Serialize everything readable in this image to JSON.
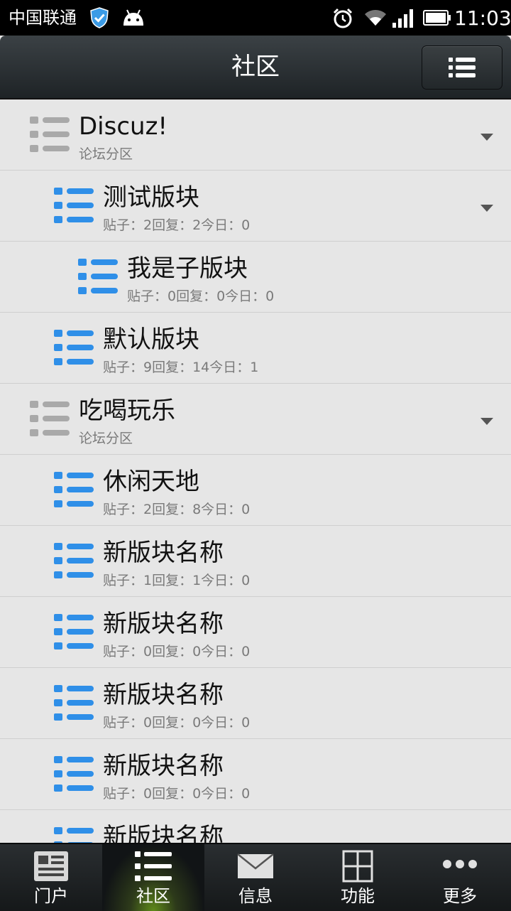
{
  "status_bar": {
    "carrier": "中国联通",
    "time": "11:03"
  },
  "header": {
    "title": "社区"
  },
  "list": {
    "rows": [
      {
        "title": "Discuz!",
        "subtitle": "论坛分区",
        "kind": "category",
        "level": 0,
        "has_arrow": true
      },
      {
        "title": "测试版块",
        "subtitle": "贴子：2回复：2今日：0",
        "kind": "forum",
        "level": 1,
        "has_arrow": true
      },
      {
        "title": "我是子版块",
        "subtitle": "贴子：0回复：0今日：0",
        "kind": "forum",
        "level": 2,
        "has_arrow": false
      },
      {
        "title": "默认版块",
        "subtitle": "贴子：9回复：14今日：1",
        "kind": "forum",
        "level": 1,
        "has_arrow": false
      },
      {
        "title": "吃喝玩乐",
        "subtitle": "论坛分区",
        "kind": "category",
        "level": 0,
        "has_arrow": true
      },
      {
        "title": "休闲天地",
        "subtitle": "贴子：2回复：8今日：0",
        "kind": "forum",
        "level": 1,
        "has_arrow": false
      },
      {
        "title": "新版块名称",
        "subtitle": "贴子：1回复：1今日：0",
        "kind": "forum",
        "level": 1,
        "has_arrow": false
      },
      {
        "title": "新版块名称",
        "subtitle": "贴子：0回复：0今日：0",
        "kind": "forum",
        "level": 1,
        "has_arrow": false
      },
      {
        "title": "新版块名称",
        "subtitle": "贴子：0回复：0今日：0",
        "kind": "forum",
        "level": 1,
        "has_arrow": false
      },
      {
        "title": "新版块名称",
        "subtitle": "贴子：0回复：0今日：0",
        "kind": "forum",
        "level": 1,
        "has_arrow": false
      },
      {
        "title": "新版块名称",
        "subtitle": "",
        "kind": "forum",
        "level": 1,
        "has_arrow": false
      }
    ]
  },
  "tabs": [
    {
      "label": "门户",
      "icon": "portal-icon",
      "active": false
    },
    {
      "label": "社区",
      "icon": "community-icon",
      "active": true
    },
    {
      "label": "信息",
      "icon": "message-icon",
      "active": false
    },
    {
      "label": "功能",
      "icon": "grid-icon",
      "active": false
    },
    {
      "label": "更多",
      "icon": "more-icon",
      "active": false
    }
  ],
  "colors": {
    "forum_icon": "#2f8fe8",
    "category_icon": "#a9a9a9",
    "tab_active_glow": "#5f8a1a"
  }
}
